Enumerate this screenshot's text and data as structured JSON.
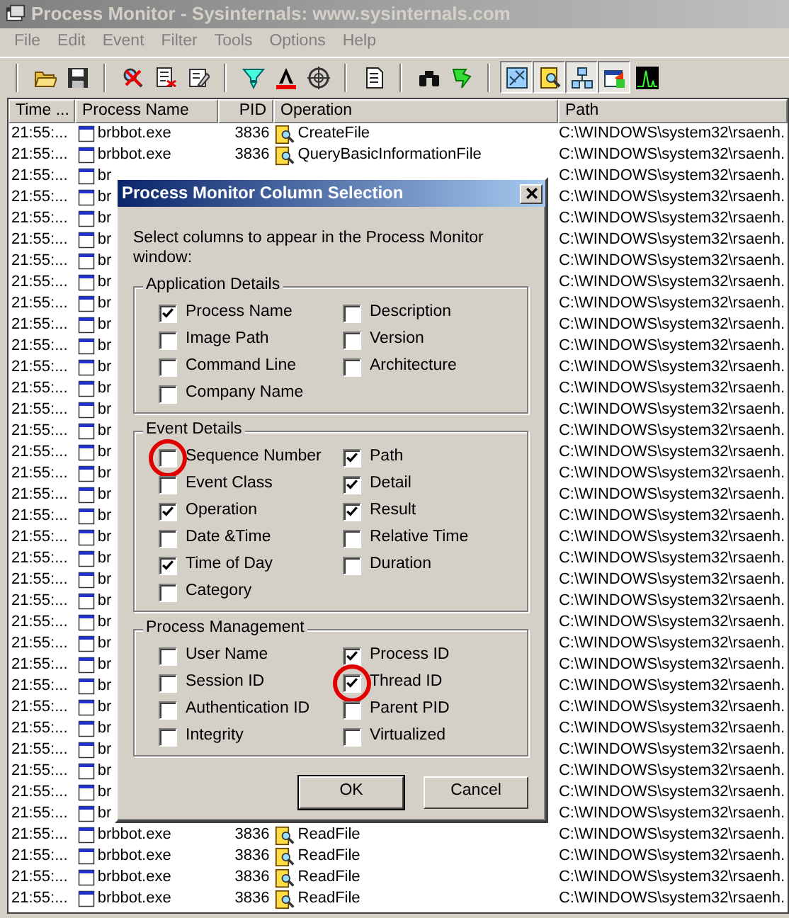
{
  "window": {
    "title": "Process Monitor - Sysinternals: www.sysinternals.com"
  },
  "menu": [
    {
      "label": "File",
      "disabled": true
    },
    {
      "label": "Edit",
      "disabled": true
    },
    {
      "label": "Event",
      "disabled": true
    },
    {
      "label": "Filter",
      "disabled": true
    },
    {
      "label": "Tools",
      "disabled": true
    },
    {
      "label": "Options",
      "disabled": true
    },
    {
      "label": "Help",
      "disabled": true
    }
  ],
  "toolbar": [
    {
      "pressed": false
    },
    {
      "pressed": false
    },
    {
      "pressed": false
    },
    {
      "pressed": false
    },
    {
      "pressed": false
    },
    {
      "pressed": false
    },
    {
      "pressed": false
    },
    {
      "pressed": false
    },
    {
      "pressed": false
    },
    {
      "pressed": false
    },
    {
      "pressed": false
    },
    {
      "pressed": true
    },
    {
      "pressed": true
    },
    {
      "pressed": true
    },
    {
      "pressed": true
    },
    {
      "pressed": false
    }
  ],
  "table": {
    "columns": [
      "Time ...",
      "Process Name",
      "PID",
      "Operation",
      "Path"
    ],
    "rows": [
      {
        "time": "21:55:...",
        "process": "brbbot.exe",
        "pid": "3836",
        "operation": "CreateFile",
        "path": "C:\\WINDOWS\\system32\\rsaenh."
      },
      {
        "time": "21:55:...",
        "process": "brbbot.exe",
        "pid": "3836",
        "operation": "QueryBasicInformationFile",
        "path": "C:\\WINDOWS\\system32\\rsaenh."
      },
      {
        "time": "21:55:...",
        "process": "br",
        "path": "C:\\WINDOWS\\system32\\rsaenh."
      },
      {
        "time": "21:55:...",
        "process": "br",
        "path": "C:\\WINDOWS\\system32\\rsaenh."
      },
      {
        "time": "21:55:...",
        "process": "br",
        "path": "C:\\WINDOWS\\system32\\rsaenh."
      },
      {
        "time": "21:55:...",
        "process": "br",
        "path": "C:\\WINDOWS\\system32\\rsaenh."
      },
      {
        "time": "21:55:...",
        "process": "br",
        "path": "C:\\WINDOWS\\system32\\rsaenh."
      },
      {
        "time": "21:55:...",
        "process": "br",
        "path": "C:\\WINDOWS\\system32\\rsaenh."
      },
      {
        "time": "21:55:...",
        "process": "br",
        "path": "C:\\WINDOWS\\system32\\rsaenh."
      },
      {
        "time": "21:55:...",
        "process": "br",
        "path": "C:\\WINDOWS\\system32\\rsaenh."
      },
      {
        "time": "21:55:...",
        "process": "br",
        "path": "C:\\WINDOWS\\system32\\rsaenh."
      },
      {
        "time": "21:55:...",
        "process": "br",
        "path": "C:\\WINDOWS\\system32\\rsaenh."
      },
      {
        "time": "21:55:...",
        "process": "br",
        "path": "C:\\WINDOWS\\system32\\rsaenh."
      },
      {
        "time": "21:55:...",
        "process": "br",
        "path": "C:\\WINDOWS\\system32\\rsaenh."
      },
      {
        "time": "21:55:...",
        "process": "br",
        "path": "C:\\WINDOWS\\system32\\rsaenh."
      },
      {
        "time": "21:55:...",
        "process": "br",
        "path": "C:\\WINDOWS\\system32\\rsaenh."
      },
      {
        "time": "21:55:...",
        "process": "br",
        "path": "C:\\WINDOWS\\system32\\rsaenh."
      },
      {
        "time": "21:55:...",
        "process": "br",
        "path": "C:\\WINDOWS\\system32\\rsaenh."
      },
      {
        "time": "21:55:...",
        "process": "br",
        "path": "C:\\WINDOWS\\system32\\rsaenh."
      },
      {
        "time": "21:55:...",
        "process": "br",
        "path": "C:\\WINDOWS\\system32\\rsaenh."
      },
      {
        "time": "21:55:...",
        "process": "br",
        "path": "C:\\WINDOWS\\system32\\rsaenh."
      },
      {
        "time": "21:55:...",
        "process": "br",
        "path": "C:\\WINDOWS\\system32\\rsaenh."
      },
      {
        "time": "21:55:...",
        "process": "br",
        "path": "C:\\WINDOWS\\system32\\rsaenh."
      },
      {
        "time": "21:55:...",
        "process": "br",
        "path": "C:\\WINDOWS\\system32\\rsaenh."
      },
      {
        "time": "21:55:...",
        "process": "br",
        "path": "C:\\WINDOWS\\system32\\rsaenh."
      },
      {
        "time": "21:55:...",
        "process": "br",
        "path": "C:\\WINDOWS\\system32\\rsaenh."
      },
      {
        "time": "21:55:...",
        "process": "br",
        "path": "C:\\WINDOWS\\system32\\rsaenh."
      },
      {
        "time": "21:55:...",
        "process": "br",
        "path": "C:\\WINDOWS\\system32\\rsaenh."
      },
      {
        "time": "21:55:...",
        "process": "br",
        "path": "C:\\WINDOWS\\system32\\rsaenh."
      },
      {
        "time": "21:55:...",
        "process": "br",
        "path": "C:\\WINDOWS\\system32\\rsaenh."
      },
      {
        "time": "21:55:...",
        "process": "br",
        "path": "C:\\WINDOWS\\system32\\rsaenh."
      },
      {
        "time": "21:55:...",
        "process": "br",
        "path": "C:\\WINDOWS\\system32\\rsaenh."
      },
      {
        "time": "21:55:...",
        "process": "br",
        "path": "C:\\WINDOWS\\system32\\rsaenh."
      },
      {
        "time": "21:55:...",
        "process": "brbbot.exe",
        "pid": "3836",
        "operation": "ReadFile",
        "path": "C:\\WINDOWS\\system32\\rsaenh."
      },
      {
        "time": "21:55:...",
        "process": "brbbot.exe",
        "pid": "3836",
        "operation": "ReadFile",
        "path": "C:\\WINDOWS\\system32\\rsaenh."
      },
      {
        "time": "21:55:...",
        "process": "brbbot.exe",
        "pid": "3836",
        "operation": "ReadFile",
        "path": "C:\\WINDOWS\\system32\\rsaenh."
      },
      {
        "time": "21:55:...",
        "process": "brbbot.exe",
        "pid": "3836",
        "operation": "ReadFile",
        "path": "C:\\WINDOWS\\system32\\rsaenh."
      }
    ]
  },
  "dialog": {
    "title": "Process Monitor Column Selection",
    "instruction": "Select columns to appear in the Process Monitor window:",
    "groups": [
      {
        "title": "Application Details",
        "columns": [
          [
            {
              "label": "Process Name",
              "checked": true,
              "circled": false
            },
            {
              "label": "Image Path",
              "checked": false,
              "circled": false
            },
            {
              "label": "Command Line",
              "checked": false,
              "circled": false
            },
            {
              "label": "Company Name",
              "checked": false,
              "circled": false
            }
          ],
          [
            {
              "label": "Description",
              "checked": false,
              "circled": false
            },
            {
              "label": "Version",
              "checked": false,
              "circled": false
            },
            {
              "label": "Architecture",
              "checked": false,
              "circled": false
            }
          ]
        ]
      },
      {
        "title": "Event Details",
        "columns": [
          [
            {
              "label": "Sequence Number",
              "checked": false,
              "circled": true
            },
            {
              "label": "Event Class",
              "checked": false,
              "circled": false
            },
            {
              "label": "Operation",
              "checked": true,
              "circled": false
            },
            {
              "label": "Date &Time",
              "checked": false,
              "circled": false
            },
            {
              "label": "Time of Day",
              "checked": true,
              "circled": false
            },
            {
              "label": "Category",
              "checked": false,
              "circled": false
            }
          ],
          [
            {
              "label": "Path",
              "checked": true,
              "circled": false
            },
            {
              "label": "Detail",
              "checked": true,
              "circled": false
            },
            {
              "label": "Result",
              "checked": true,
              "circled": false
            },
            {
              "label": "Relative Time",
              "checked": false,
              "circled": false
            },
            {
              "label": "Duration",
              "checked": false,
              "circled": false
            }
          ]
        ]
      },
      {
        "title": "Process Management",
        "columns": [
          [
            {
              "label": "User Name",
              "checked": false,
              "circled": false
            },
            {
              "label": "Session ID",
              "checked": false,
              "circled": false
            },
            {
              "label": "Authentication ID",
              "checked": false,
              "circled": false
            },
            {
              "label": "Integrity",
              "checked": false,
              "circled": false
            }
          ],
          [
            {
              "label": "Process ID",
              "checked": true,
              "circled": false
            },
            {
              "label": "Thread ID",
              "checked": true,
              "circled": true
            },
            {
              "label": "Parent PID",
              "checked": false,
              "circled": false
            },
            {
              "label": "Virtualized",
              "checked": false,
              "circled": false
            }
          ]
        ]
      }
    ],
    "buttons": [
      {
        "label": "OK",
        "default": true
      },
      {
        "label": "Cancel",
        "default": false
      }
    ]
  }
}
